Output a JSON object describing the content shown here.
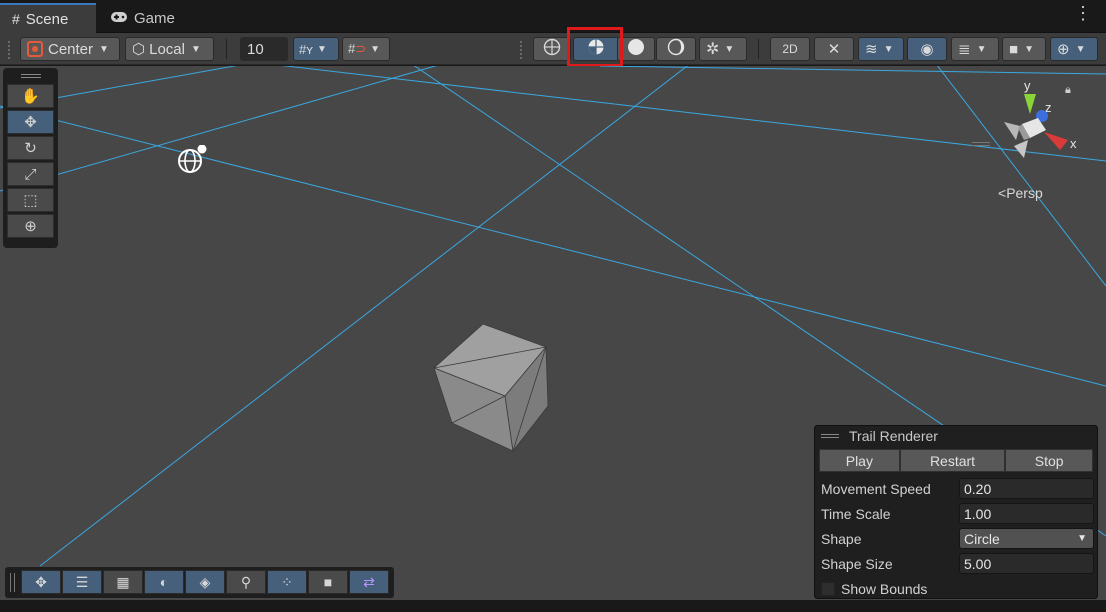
{
  "tabs": [
    {
      "label": "Scene",
      "icon": "hash-icon",
      "active": true
    },
    {
      "label": "Game",
      "icon": "gamepad-icon",
      "active": false
    }
  ],
  "toolbar": {
    "pivot": "Center",
    "space": "Local",
    "grid_size": "10",
    "highlighted_button": "shaded-wireframe-draw-mode"
  },
  "tool_palette": [
    "hand-tool",
    "move-tool",
    "rotate-tool",
    "scale-tool",
    "rect-tool",
    "transform-tool"
  ],
  "gizmo": {
    "view": "Persp",
    "axes": [
      "y",
      "z",
      "x"
    ]
  },
  "trail_renderer": {
    "title": "Trail Renderer",
    "buttons": [
      "Play",
      "Restart",
      "Stop"
    ],
    "fields": [
      {
        "label": "Movement Speed",
        "value": "0.20"
      },
      {
        "label": "Time Scale",
        "value": "1.00"
      },
      {
        "label": "Shape",
        "value": "Circle"
      },
      {
        "label": "Shape Size",
        "value": "5.00"
      }
    ],
    "show_bounds": "Show Bounds"
  },
  "colors": {
    "accent": "#46607c",
    "highlight": "#e01a1a",
    "grid": "#3aa8e0",
    "scene_bg": "#474747"
  }
}
